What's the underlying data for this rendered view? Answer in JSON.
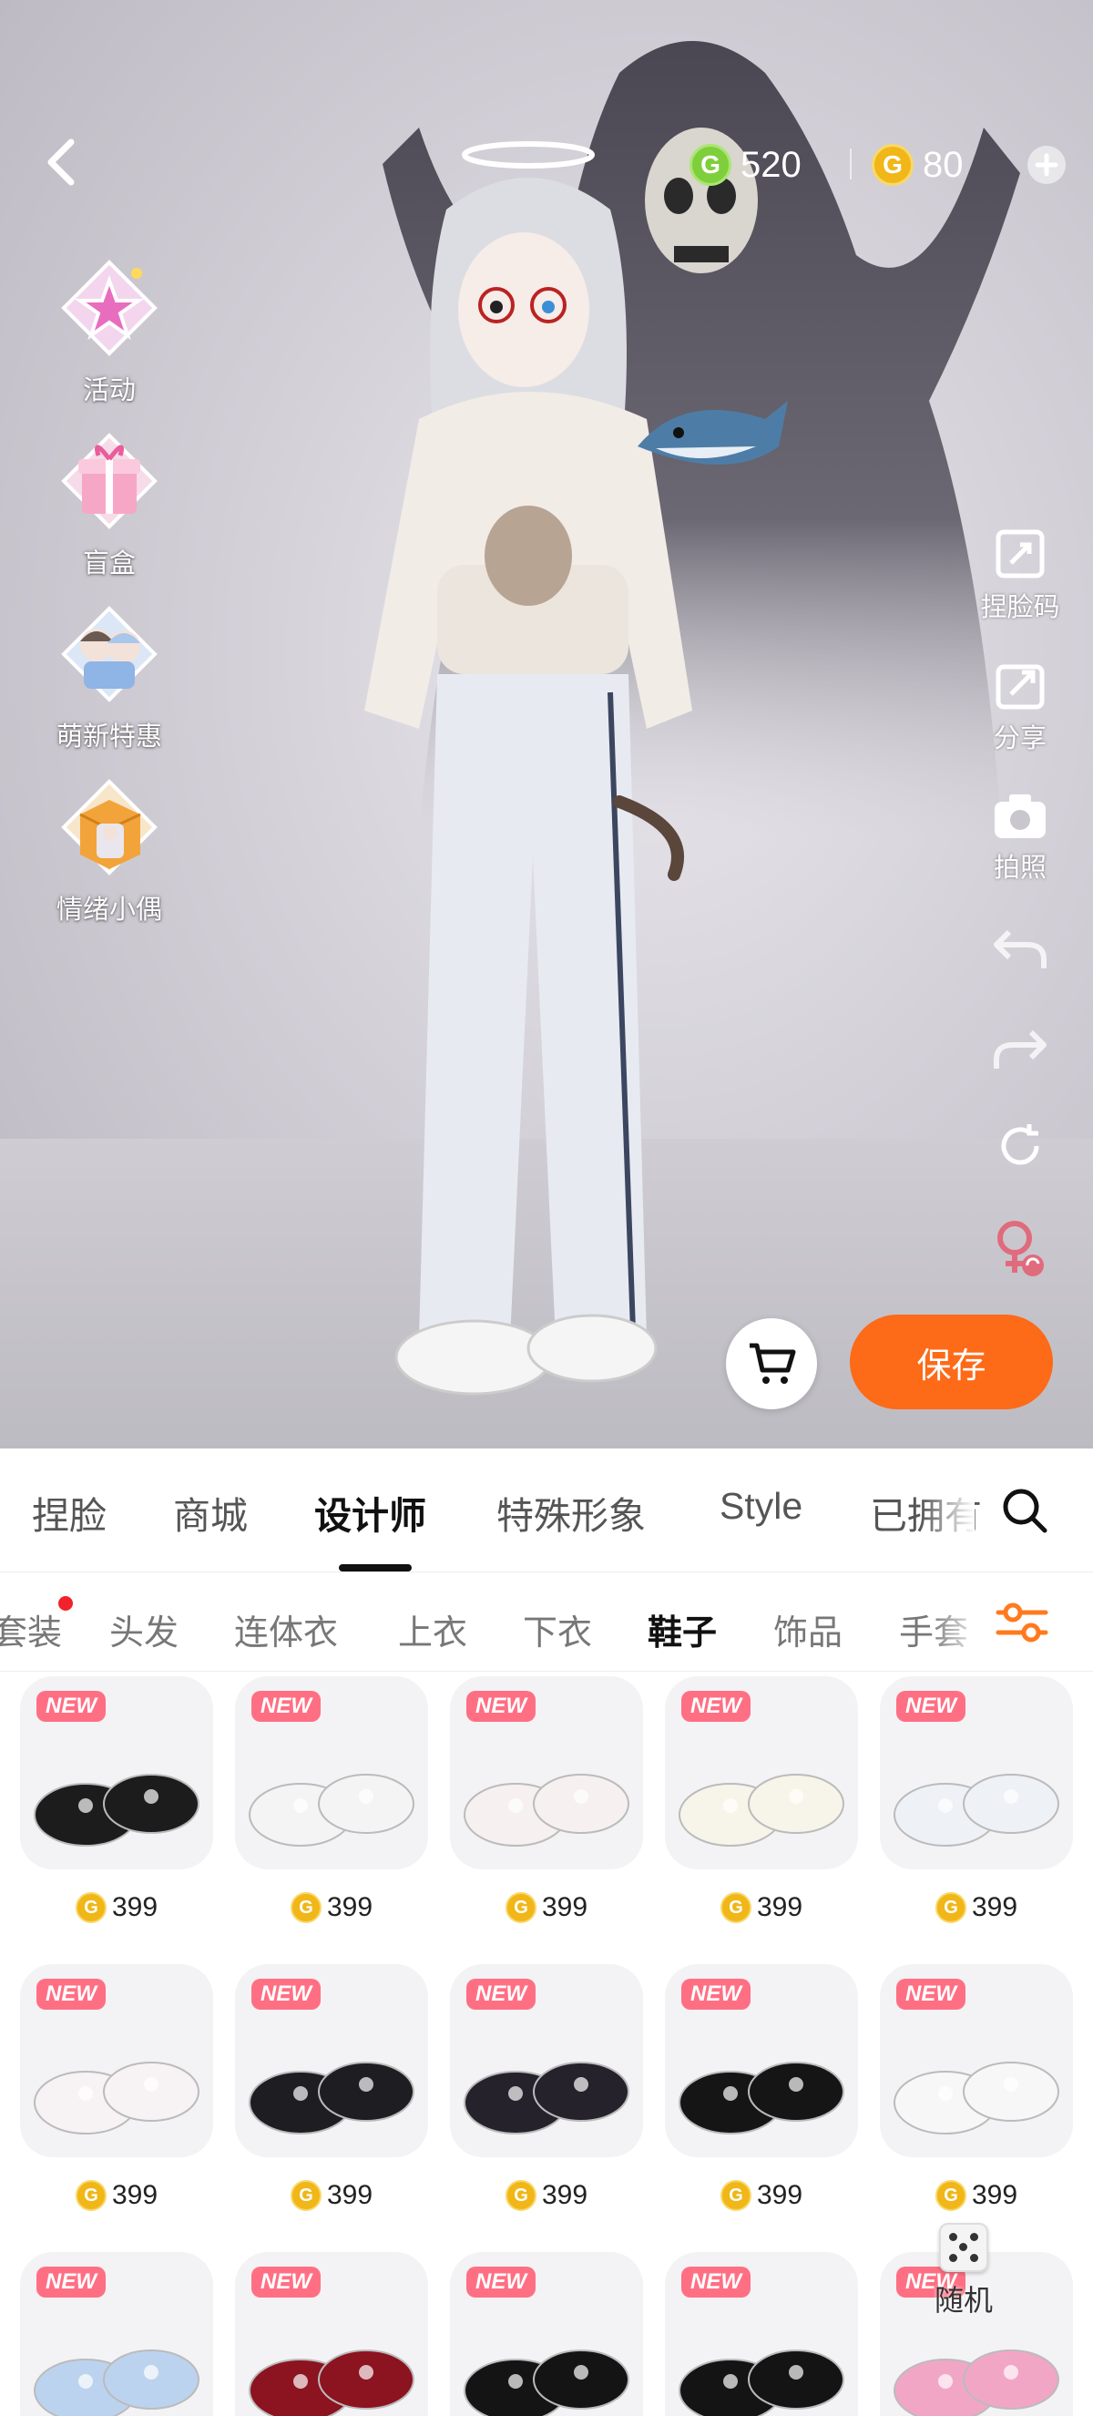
{
  "header": {
    "currency_g": "520",
    "currency_gold": "80"
  },
  "left_menu": [
    {
      "label": "活动",
      "icon": "star-badge-icon"
    },
    {
      "label": "盲盒",
      "icon": "gift-box-icon"
    },
    {
      "label": "萌新特惠",
      "icon": "character-card-icon"
    },
    {
      "label": "情绪小偶",
      "icon": "doll-box-icon"
    }
  ],
  "right_tools": [
    {
      "label": "捏脸码",
      "icon": "face-code-icon"
    },
    {
      "label": "分享",
      "icon": "share-icon"
    },
    {
      "label": "拍照",
      "icon": "camera-icon"
    },
    {
      "label": "",
      "icon": "undo-icon"
    },
    {
      "label": "",
      "icon": "redo-icon"
    },
    {
      "label": "",
      "icon": "reset-icon"
    },
    {
      "label": "",
      "icon": "gender-switch-icon"
    }
  ],
  "actions": {
    "save_label": "保存"
  },
  "tabs": [
    "捏脸",
    "商城",
    "设计师",
    "特殊形象",
    "Style",
    "已拥有"
  ],
  "active_tab": "设计师",
  "categories": [
    "套装",
    "头发",
    "连体衣",
    "上衣",
    "下衣",
    "鞋子",
    "饰品",
    "手套"
  ],
  "active_category": "鞋子",
  "items": [
    {
      "badge": "NEW",
      "price": "399",
      "color": "#1c1c1c"
    },
    {
      "badge": "NEW",
      "price": "399",
      "color": "#f4f4f4"
    },
    {
      "badge": "NEW",
      "price": "399",
      "color": "#f6f0f0"
    },
    {
      "badge": "NEW",
      "price": "399",
      "color": "#f7f5ea"
    },
    {
      "badge": "NEW",
      "price": "399",
      "color": "#eef1f6"
    },
    {
      "badge": "NEW",
      "price": "399",
      "color": "#f7f2f4"
    },
    {
      "badge": "NEW",
      "price": "399",
      "color": "#1d1d22"
    },
    {
      "badge": "NEW",
      "price": "399",
      "color": "#25222c"
    },
    {
      "badge": "NEW",
      "price": "399",
      "color": "#151515"
    },
    {
      "badge": "NEW",
      "price": "399",
      "color": "#f7f7f7"
    },
    {
      "badge": "NEW",
      "price": "",
      "color": "#bcd3ef"
    },
    {
      "badge": "NEW",
      "price": "",
      "color": "#8c1320"
    },
    {
      "badge": "NEW",
      "price": "",
      "color": "#141414"
    },
    {
      "badge": "NEW",
      "price": "",
      "color": "#141414"
    },
    {
      "badge": "NEW",
      "price": "",
      "color": "#f2a6c6"
    }
  ],
  "random": {
    "label": "随机"
  }
}
